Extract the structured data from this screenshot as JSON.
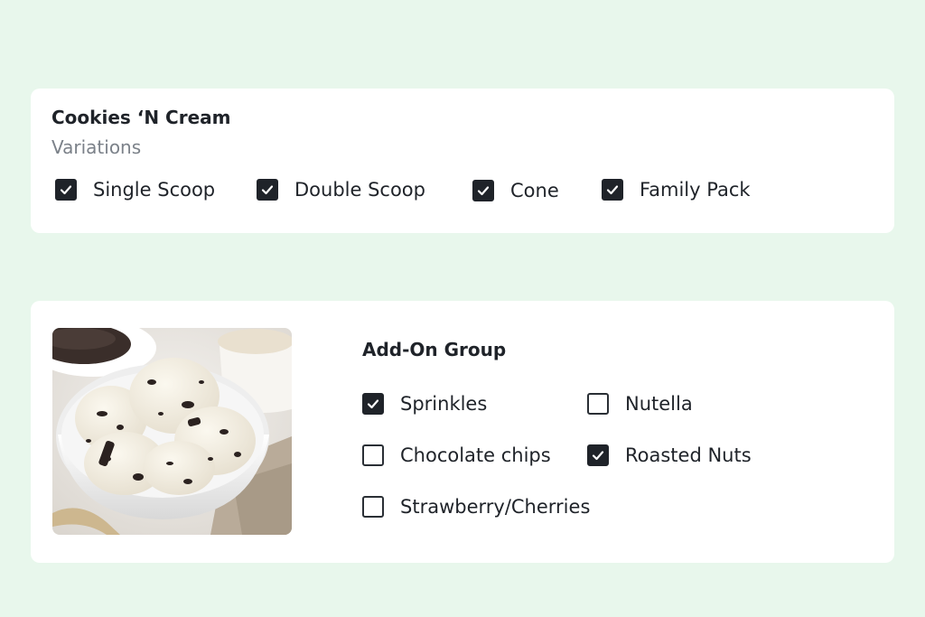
{
  "product": {
    "title": "Cookies ‘N Cream"
  },
  "variations": {
    "heading": "Variations",
    "options": [
      {
        "label": "Single Scoop",
        "checked": true
      },
      {
        "label": "Double Scoop",
        "checked": true
      },
      {
        "label": "Cone",
        "checked": true
      },
      {
        "label": "Family Pack",
        "checked": true
      }
    ]
  },
  "addons": {
    "heading": "Add-On Group",
    "options": [
      {
        "label": "Sprinkles",
        "checked": true
      },
      {
        "label": "Nutella",
        "checked": false
      },
      {
        "label": "Chocolate chips",
        "checked": false
      },
      {
        "label": "Roasted Nuts",
        "checked": true
      },
      {
        "label": "Strawberry/Cherries",
        "checked": false
      }
    ]
  },
  "image": {
    "subject": "ice-cream-bowl"
  },
  "colors": {
    "background": "#e8f7ec",
    "card": "#ffffff",
    "checkbox_checked": "#1f2329",
    "subtitle": "#7b8189"
  }
}
